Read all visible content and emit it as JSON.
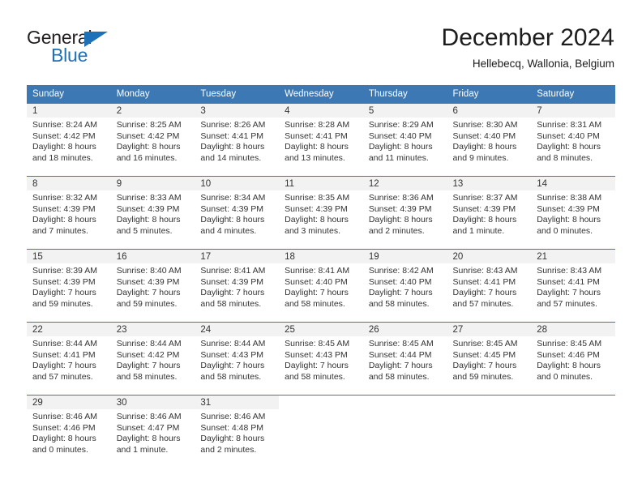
{
  "brand": {
    "name_top": "General",
    "name_bottom": "Blue",
    "accent_color": "#1d71b8"
  },
  "header": {
    "month_title": "December 2024",
    "location": "Hellebecq, Wallonia, Belgium"
  },
  "calendar": {
    "header_bg": "#3b78b4",
    "daynum_bg": "#f2f2f2",
    "weekdays": [
      "Sunday",
      "Monday",
      "Tuesday",
      "Wednesday",
      "Thursday",
      "Friday",
      "Saturday"
    ],
    "weeks": [
      [
        {
          "day": "1",
          "sunrise": "Sunrise: 8:24 AM",
          "sunset": "Sunset: 4:42 PM",
          "daylight_line1": "Daylight: 8 hours",
          "daylight_line2": "and 18 minutes."
        },
        {
          "day": "2",
          "sunrise": "Sunrise: 8:25 AM",
          "sunset": "Sunset: 4:42 PM",
          "daylight_line1": "Daylight: 8 hours",
          "daylight_line2": "and 16 minutes."
        },
        {
          "day": "3",
          "sunrise": "Sunrise: 8:26 AM",
          "sunset": "Sunset: 4:41 PM",
          "daylight_line1": "Daylight: 8 hours",
          "daylight_line2": "and 14 minutes."
        },
        {
          "day": "4",
          "sunrise": "Sunrise: 8:28 AM",
          "sunset": "Sunset: 4:41 PM",
          "daylight_line1": "Daylight: 8 hours",
          "daylight_line2": "and 13 minutes."
        },
        {
          "day": "5",
          "sunrise": "Sunrise: 8:29 AM",
          "sunset": "Sunset: 4:40 PM",
          "daylight_line1": "Daylight: 8 hours",
          "daylight_line2": "and 11 minutes."
        },
        {
          "day": "6",
          "sunrise": "Sunrise: 8:30 AM",
          "sunset": "Sunset: 4:40 PM",
          "daylight_line1": "Daylight: 8 hours",
          "daylight_line2": "and 9 minutes."
        },
        {
          "day": "7",
          "sunrise": "Sunrise: 8:31 AM",
          "sunset": "Sunset: 4:40 PM",
          "daylight_line1": "Daylight: 8 hours",
          "daylight_line2": "and 8 minutes."
        }
      ],
      [
        {
          "day": "8",
          "sunrise": "Sunrise: 8:32 AM",
          "sunset": "Sunset: 4:39 PM",
          "daylight_line1": "Daylight: 8 hours",
          "daylight_line2": "and 7 minutes."
        },
        {
          "day": "9",
          "sunrise": "Sunrise: 8:33 AM",
          "sunset": "Sunset: 4:39 PM",
          "daylight_line1": "Daylight: 8 hours",
          "daylight_line2": "and 5 minutes."
        },
        {
          "day": "10",
          "sunrise": "Sunrise: 8:34 AM",
          "sunset": "Sunset: 4:39 PM",
          "daylight_line1": "Daylight: 8 hours",
          "daylight_line2": "and 4 minutes."
        },
        {
          "day": "11",
          "sunrise": "Sunrise: 8:35 AM",
          "sunset": "Sunset: 4:39 PM",
          "daylight_line1": "Daylight: 8 hours",
          "daylight_line2": "and 3 minutes."
        },
        {
          "day": "12",
          "sunrise": "Sunrise: 8:36 AM",
          "sunset": "Sunset: 4:39 PM",
          "daylight_line1": "Daylight: 8 hours",
          "daylight_line2": "and 2 minutes."
        },
        {
          "day": "13",
          "sunrise": "Sunrise: 8:37 AM",
          "sunset": "Sunset: 4:39 PM",
          "daylight_line1": "Daylight: 8 hours",
          "daylight_line2": "and 1 minute."
        },
        {
          "day": "14",
          "sunrise": "Sunrise: 8:38 AM",
          "sunset": "Sunset: 4:39 PM",
          "daylight_line1": "Daylight: 8 hours",
          "daylight_line2": "and 0 minutes."
        }
      ],
      [
        {
          "day": "15",
          "sunrise": "Sunrise: 8:39 AM",
          "sunset": "Sunset: 4:39 PM",
          "daylight_line1": "Daylight: 7 hours",
          "daylight_line2": "and 59 minutes."
        },
        {
          "day": "16",
          "sunrise": "Sunrise: 8:40 AM",
          "sunset": "Sunset: 4:39 PM",
          "daylight_line1": "Daylight: 7 hours",
          "daylight_line2": "and 59 minutes."
        },
        {
          "day": "17",
          "sunrise": "Sunrise: 8:41 AM",
          "sunset": "Sunset: 4:39 PM",
          "daylight_line1": "Daylight: 7 hours",
          "daylight_line2": "and 58 minutes."
        },
        {
          "day": "18",
          "sunrise": "Sunrise: 8:41 AM",
          "sunset": "Sunset: 4:40 PM",
          "daylight_line1": "Daylight: 7 hours",
          "daylight_line2": "and 58 minutes."
        },
        {
          "day": "19",
          "sunrise": "Sunrise: 8:42 AM",
          "sunset": "Sunset: 4:40 PM",
          "daylight_line1": "Daylight: 7 hours",
          "daylight_line2": "and 58 minutes."
        },
        {
          "day": "20",
          "sunrise": "Sunrise: 8:43 AM",
          "sunset": "Sunset: 4:41 PM",
          "daylight_line1": "Daylight: 7 hours",
          "daylight_line2": "and 57 minutes."
        },
        {
          "day": "21",
          "sunrise": "Sunrise: 8:43 AM",
          "sunset": "Sunset: 4:41 PM",
          "daylight_line1": "Daylight: 7 hours",
          "daylight_line2": "and 57 minutes."
        }
      ],
      [
        {
          "day": "22",
          "sunrise": "Sunrise: 8:44 AM",
          "sunset": "Sunset: 4:41 PM",
          "daylight_line1": "Daylight: 7 hours",
          "daylight_line2": "and 57 minutes."
        },
        {
          "day": "23",
          "sunrise": "Sunrise: 8:44 AM",
          "sunset": "Sunset: 4:42 PM",
          "daylight_line1": "Daylight: 7 hours",
          "daylight_line2": "and 58 minutes."
        },
        {
          "day": "24",
          "sunrise": "Sunrise: 8:44 AM",
          "sunset": "Sunset: 4:43 PM",
          "daylight_line1": "Daylight: 7 hours",
          "daylight_line2": "and 58 minutes."
        },
        {
          "day": "25",
          "sunrise": "Sunrise: 8:45 AM",
          "sunset": "Sunset: 4:43 PM",
          "daylight_line1": "Daylight: 7 hours",
          "daylight_line2": "and 58 minutes."
        },
        {
          "day": "26",
          "sunrise": "Sunrise: 8:45 AM",
          "sunset": "Sunset: 4:44 PM",
          "daylight_line1": "Daylight: 7 hours",
          "daylight_line2": "and 58 minutes."
        },
        {
          "day": "27",
          "sunrise": "Sunrise: 8:45 AM",
          "sunset": "Sunset: 4:45 PM",
          "daylight_line1": "Daylight: 7 hours",
          "daylight_line2": "and 59 minutes."
        },
        {
          "day": "28",
          "sunrise": "Sunrise: 8:45 AM",
          "sunset": "Sunset: 4:46 PM",
          "daylight_line1": "Daylight: 8 hours",
          "daylight_line2": "and 0 minutes."
        }
      ],
      [
        {
          "day": "29",
          "sunrise": "Sunrise: 8:46 AM",
          "sunset": "Sunset: 4:46 PM",
          "daylight_line1": "Daylight: 8 hours",
          "daylight_line2": "and 0 minutes."
        },
        {
          "day": "30",
          "sunrise": "Sunrise: 8:46 AM",
          "sunset": "Sunset: 4:47 PM",
          "daylight_line1": "Daylight: 8 hours",
          "daylight_line2": "and 1 minute."
        },
        {
          "day": "31",
          "sunrise": "Sunrise: 8:46 AM",
          "sunset": "Sunset: 4:48 PM",
          "daylight_line1": "Daylight: 8 hours",
          "daylight_line2": "and 2 minutes."
        },
        {
          "day": "",
          "sunrise": "",
          "sunset": "",
          "daylight_line1": "",
          "daylight_line2": ""
        },
        {
          "day": "",
          "sunrise": "",
          "sunset": "",
          "daylight_line1": "",
          "daylight_line2": ""
        },
        {
          "day": "",
          "sunrise": "",
          "sunset": "",
          "daylight_line1": "",
          "daylight_line2": ""
        },
        {
          "day": "",
          "sunrise": "",
          "sunset": "",
          "daylight_line1": "",
          "daylight_line2": ""
        }
      ]
    ]
  }
}
